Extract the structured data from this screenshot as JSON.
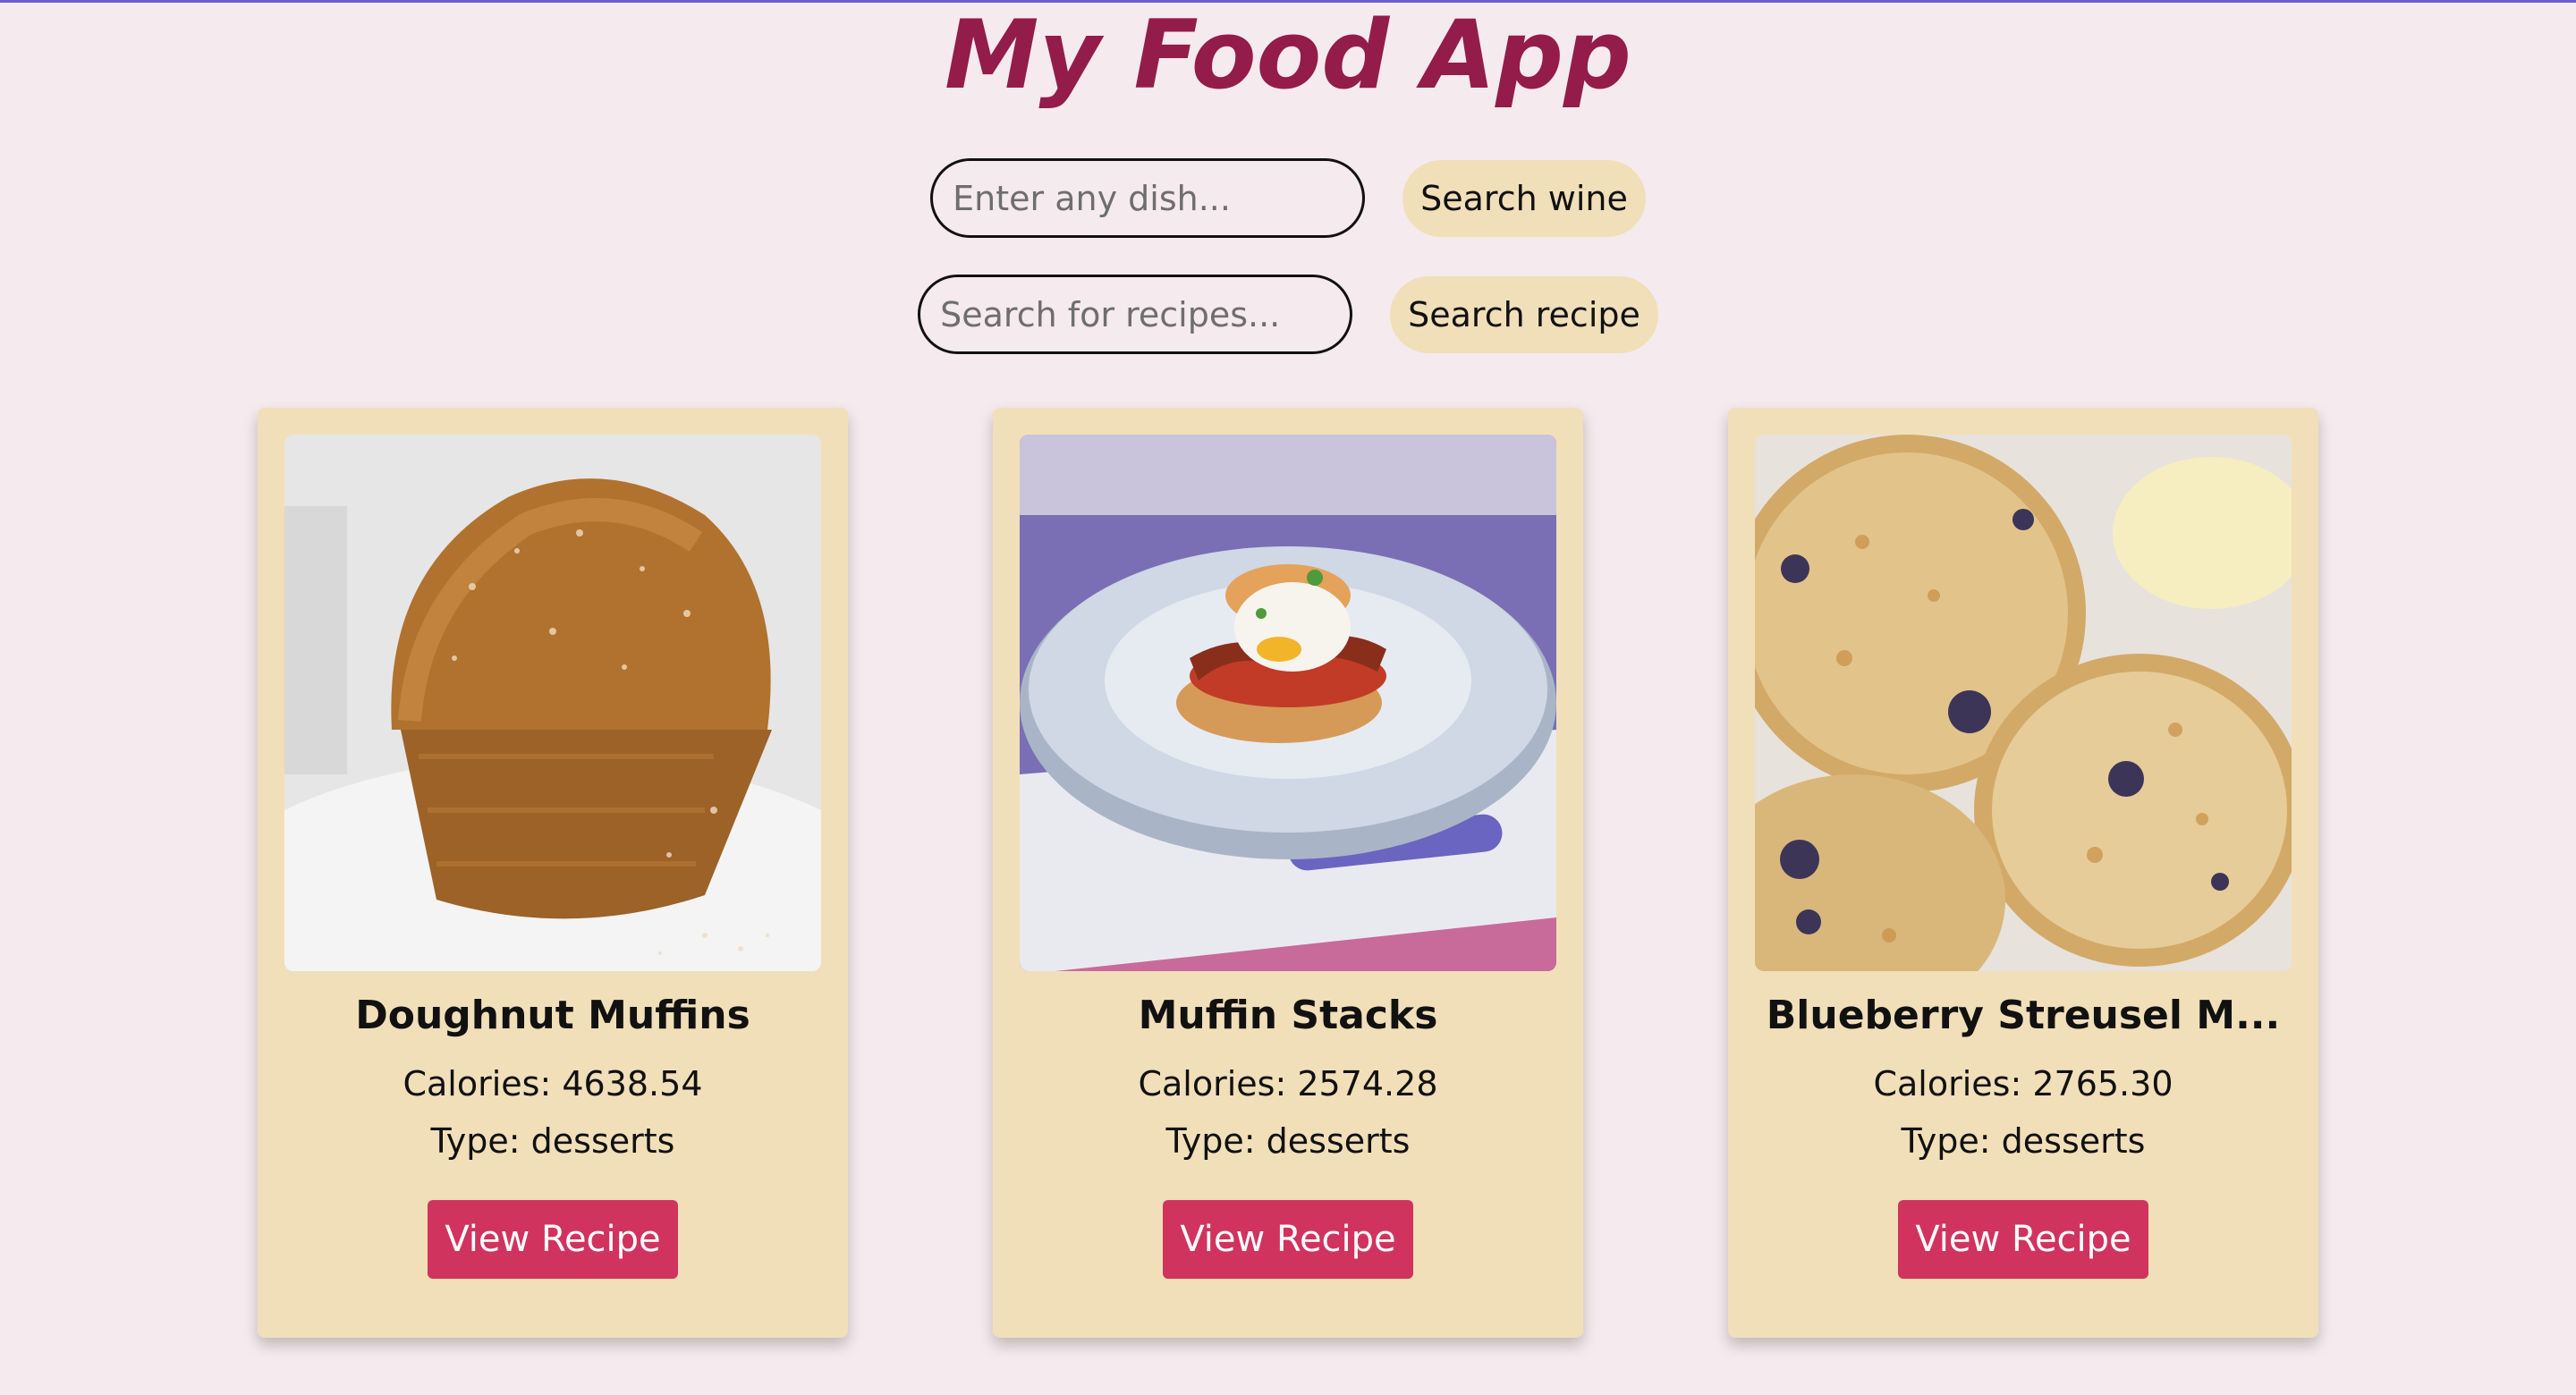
{
  "app": {
    "title": "My Food App"
  },
  "wine_search": {
    "placeholder": "Enter any dish...",
    "button_label": "Search wine"
  },
  "recipe_search": {
    "placeholder": "Search for recipes...",
    "button_label": "Search recipe"
  },
  "recipes": [
    {
      "title": "Doughnut Muffins",
      "calories": "Calories: 4638.54",
      "type": "Type: desserts",
      "button_label": "View Recipe",
      "image": "doughnut-muffin-photo"
    },
    {
      "title": "Muffin Stacks",
      "calories": "Calories: 2574.28",
      "type": "Type: desserts",
      "button_label": "View Recipe",
      "image": "muffin-stack-photo"
    },
    {
      "title": "Blueberry Streusel M...",
      "calories": "Calories: 2765.30",
      "type": "Type: desserts",
      "button_label": "View Recipe",
      "image": "blueberry-muffins-photo"
    }
  ],
  "colors": {
    "background": "#f5eaee",
    "title": "#931c4a",
    "card": "#f1dfb9",
    "button": "#d1335f"
  }
}
